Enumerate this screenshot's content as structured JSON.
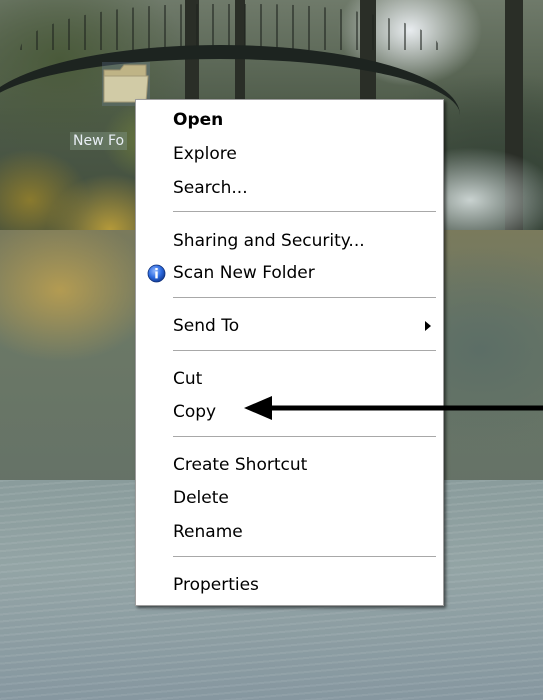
{
  "desktop": {
    "folder_label": "New Fo"
  },
  "context_menu": {
    "items": [
      {
        "label": "Open",
        "bold": true
      },
      {
        "label": "Explore"
      },
      {
        "label": "Search..."
      },
      {
        "label": "Sharing and Security..."
      },
      {
        "label": "Scan New Folder",
        "icon": "scan-icon"
      },
      {
        "label": "Send To",
        "has_submenu": true
      },
      {
        "label": "Cut"
      },
      {
        "label": "Copy"
      },
      {
        "label": "Create Shortcut"
      },
      {
        "label": "Delete"
      },
      {
        "label": "Rename"
      },
      {
        "label": "Properties"
      }
    ]
  },
  "annotation": {
    "arrow_target": "Copy",
    "arrow_color": "#000000"
  },
  "colors": {
    "menu_background": "#ffffff",
    "menu_border": "#9d9d9d",
    "separator": "#a8a8a8",
    "scan_icon_blue": "#1f5bd4"
  }
}
